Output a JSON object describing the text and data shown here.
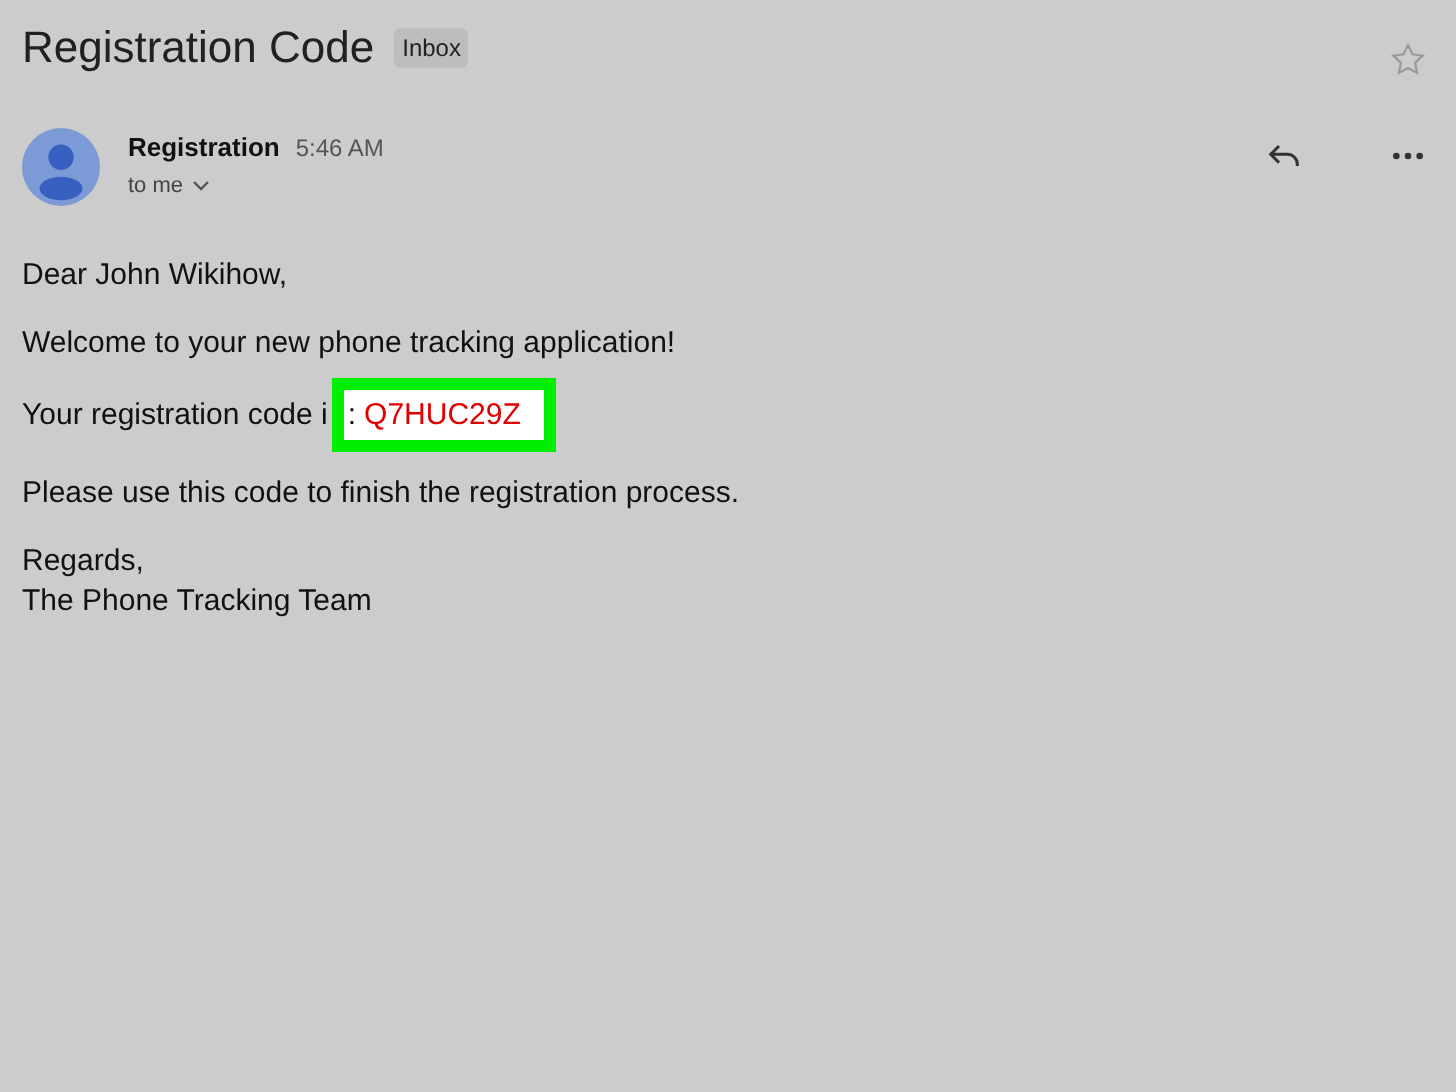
{
  "subject": "Registration Code",
  "label": "Inbox",
  "sender": {
    "name": "Registration",
    "time": "5:46 AM",
    "recipient": "to me"
  },
  "body": {
    "greeting": "Dear John Wikihow,",
    "welcome": "Welcome to your new phone tracking application!",
    "code_line": {
      "lead": "Your registration code i",
      "colon": ":",
      "code": "Q7HUC29Z",
      "highlighted": true
    },
    "instruction": "Please use this code to finish the registration process.",
    "closing": "Regards,",
    "signature": "The Phone Tracking Team"
  }
}
